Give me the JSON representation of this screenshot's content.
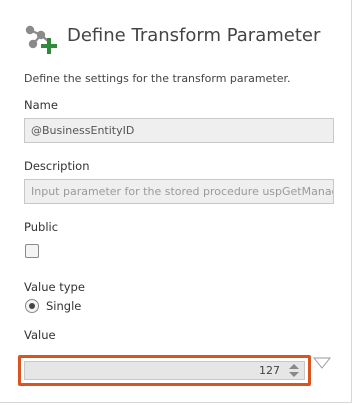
{
  "dialog": {
    "title": "Define Transform Parameter",
    "description": "Define the settings for the transform parameter.",
    "icon": "transform-parameter-icon"
  },
  "fields": {
    "name": {
      "label": "Name",
      "value": "@BusinessEntityID"
    },
    "description": {
      "label": "Description",
      "placeholder": "Input parameter for the stored procedure uspGetManag"
    },
    "public": {
      "label": "Public",
      "checked": false
    },
    "value_type": {
      "label": "Value type",
      "selected": "Single"
    },
    "value": {
      "label": "Value",
      "number": "127"
    }
  },
  "colors": {
    "highlight": "#d9541e",
    "icon_plus": "#2e8b3a",
    "icon_nodes": "#8a8a8a"
  }
}
